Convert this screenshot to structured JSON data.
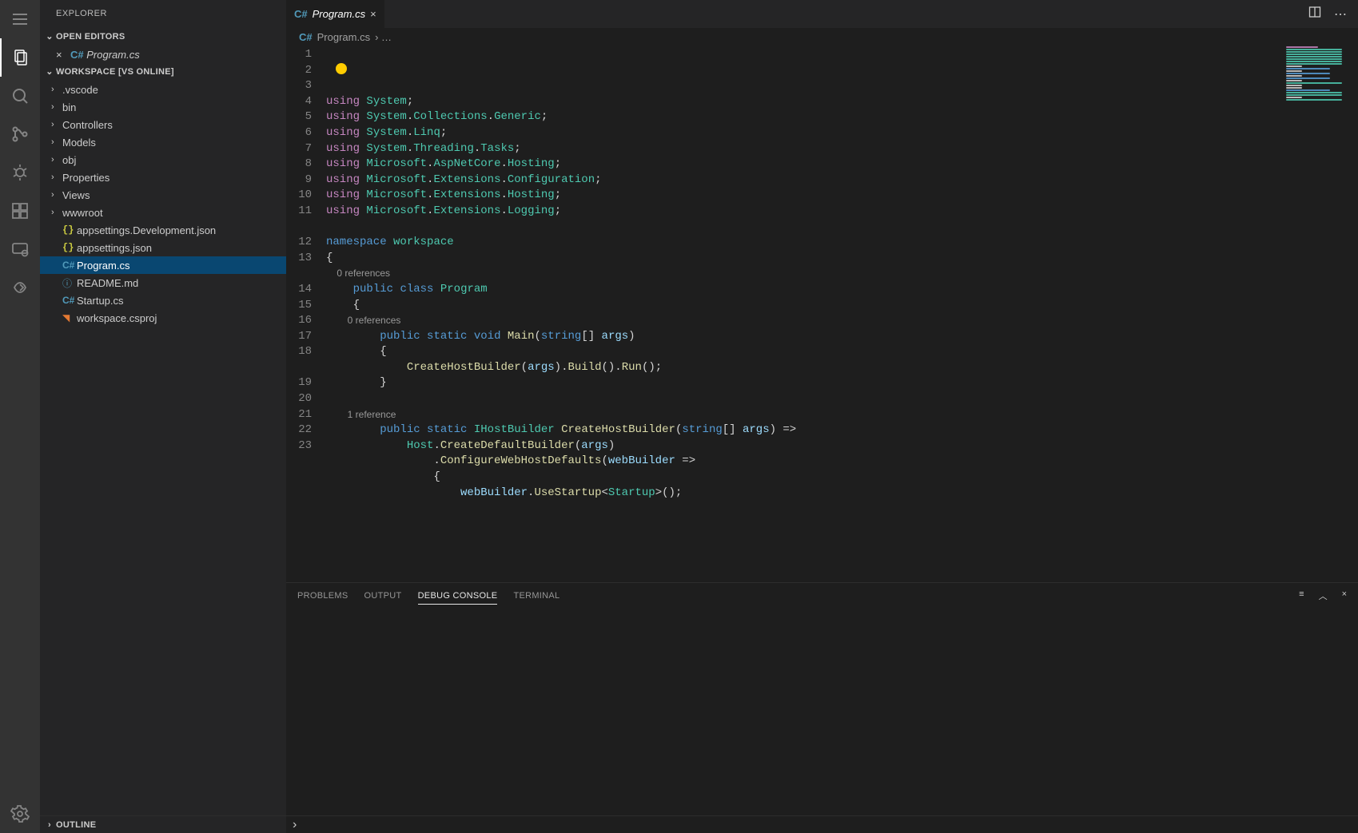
{
  "sidebar": {
    "title": "EXPLORER",
    "openEditorsHeader": "OPEN EDITORS",
    "openEditors": [
      {
        "name": "Program.cs"
      }
    ],
    "workspaceHeader": "WORKSPACE [VS ONLINE]",
    "folders": [
      {
        "name": ".vscode"
      },
      {
        "name": "bin"
      },
      {
        "name": "Controllers"
      },
      {
        "name": "Models"
      },
      {
        "name": "obj"
      },
      {
        "name": "Properties"
      },
      {
        "name": "Views"
      },
      {
        "name": "wwwroot"
      }
    ],
    "files": [
      {
        "name": "appsettings.Development.json",
        "icon": "json"
      },
      {
        "name": "appsettings.json",
        "icon": "json"
      },
      {
        "name": "Program.cs",
        "icon": "cs",
        "selected": true
      },
      {
        "name": "README.md",
        "icon": "info"
      },
      {
        "name": "Startup.cs",
        "icon": "cs"
      },
      {
        "name": "workspace.csproj",
        "icon": "rss"
      }
    ],
    "outlineHeader": "OUTLINE"
  },
  "tab": {
    "name": "Program.cs"
  },
  "breadcrumb": {
    "file": "Program.cs",
    "rest": "›  …"
  },
  "codelens": {
    "zero": "0 references",
    "one": "1 reference"
  },
  "code": {
    "l1": [
      [
        "kw",
        "using"
      ],
      [
        "plain",
        " "
      ],
      [
        "ns",
        "System"
      ],
      [
        "plain",
        ";"
      ]
    ],
    "l2": [
      [
        "kw",
        "using"
      ],
      [
        "plain",
        " "
      ],
      [
        "ns",
        "System"
      ],
      [
        "plain",
        "."
      ],
      [
        "ns",
        "Collections"
      ],
      [
        "plain",
        "."
      ],
      [
        "ns",
        "Generic"
      ],
      [
        "plain",
        ";"
      ]
    ],
    "l3": [
      [
        "kw",
        "using"
      ],
      [
        "plain",
        " "
      ],
      [
        "ns",
        "System"
      ],
      [
        "plain",
        "."
      ],
      [
        "ns",
        "Linq"
      ],
      [
        "plain",
        ";"
      ]
    ],
    "l4": [
      [
        "kw",
        "using"
      ],
      [
        "plain",
        " "
      ],
      [
        "ns",
        "System"
      ],
      [
        "plain",
        "."
      ],
      [
        "ns",
        "Threading"
      ],
      [
        "plain",
        "."
      ],
      [
        "ns",
        "Tasks"
      ],
      [
        "plain",
        ";"
      ]
    ],
    "l5": [
      [
        "kw",
        "using"
      ],
      [
        "plain",
        " "
      ],
      [
        "ns",
        "Microsoft"
      ],
      [
        "plain",
        "."
      ],
      [
        "ns",
        "AspNetCore"
      ],
      [
        "plain",
        "."
      ],
      [
        "ns",
        "Hosting"
      ],
      [
        "plain",
        ";"
      ]
    ],
    "l6": [
      [
        "kw",
        "using"
      ],
      [
        "plain",
        " "
      ],
      [
        "ns",
        "Microsoft"
      ],
      [
        "plain",
        "."
      ],
      [
        "ns",
        "Extensions"
      ],
      [
        "plain",
        "."
      ],
      [
        "ns",
        "Configuration"
      ],
      [
        "plain",
        ";"
      ]
    ],
    "l7": [
      [
        "kw",
        "using"
      ],
      [
        "plain",
        " "
      ],
      [
        "ns",
        "Microsoft"
      ],
      [
        "plain",
        "."
      ],
      [
        "ns",
        "Extensions"
      ],
      [
        "plain",
        "."
      ],
      [
        "ns",
        "Hosting"
      ],
      [
        "plain",
        ";"
      ]
    ],
    "l8": [
      [
        "kw",
        "using"
      ],
      [
        "plain",
        " "
      ],
      [
        "ns",
        "Microsoft"
      ],
      [
        "plain",
        "."
      ],
      [
        "ns",
        "Extensions"
      ],
      [
        "plain",
        "."
      ],
      [
        "ns",
        "Logging"
      ],
      [
        "plain",
        ";"
      ]
    ],
    "l9": [],
    "l10": [
      [
        "kw2",
        "namespace"
      ],
      [
        "plain",
        " "
      ],
      [
        "ns",
        "workspace"
      ]
    ],
    "l11": [
      [
        "plain",
        "{"
      ]
    ],
    "l12": [
      [
        "plain",
        "    "
      ],
      [
        "kw2",
        "public"
      ],
      [
        "plain",
        " "
      ],
      [
        "kw2",
        "class"
      ],
      [
        "plain",
        " "
      ],
      [
        "ns",
        "Program"
      ]
    ],
    "l13": [
      [
        "plain",
        "    {"
      ]
    ],
    "l14": [
      [
        "plain",
        "        "
      ],
      [
        "kw2",
        "public"
      ],
      [
        "plain",
        " "
      ],
      [
        "kw2",
        "static"
      ],
      [
        "plain",
        " "
      ],
      [
        "kw2",
        "void"
      ],
      [
        "plain",
        " "
      ],
      [
        "fn",
        "Main"
      ],
      [
        "plain",
        "("
      ],
      [
        "kw2",
        "string"
      ],
      [
        "plain",
        "[] "
      ],
      [
        "var",
        "args"
      ],
      [
        "plain",
        ")"
      ]
    ],
    "l15": [
      [
        "plain",
        "        {"
      ]
    ],
    "l16": [
      [
        "plain",
        "            "
      ],
      [
        "fn",
        "CreateHostBuilder"
      ],
      [
        "plain",
        "("
      ],
      [
        "var",
        "args"
      ],
      [
        "plain",
        ")."
      ],
      [
        "fn",
        "Build"
      ],
      [
        "plain",
        "()."
      ],
      [
        "fn",
        "Run"
      ],
      [
        "plain",
        "();"
      ]
    ],
    "l17": [
      [
        "plain",
        "        }"
      ]
    ],
    "l18": [],
    "l19": [
      [
        "plain",
        "        "
      ],
      [
        "kw2",
        "public"
      ],
      [
        "plain",
        " "
      ],
      [
        "kw2",
        "static"
      ],
      [
        "plain",
        " "
      ],
      [
        "ns",
        "IHostBuilder"
      ],
      [
        "plain",
        " "
      ],
      [
        "fn",
        "CreateHostBuilder"
      ],
      [
        "plain",
        "("
      ],
      [
        "kw2",
        "string"
      ],
      [
        "plain",
        "[] "
      ],
      [
        "var",
        "args"
      ],
      [
        "plain",
        ") =>"
      ]
    ],
    "l20": [
      [
        "plain",
        "            "
      ],
      [
        "ns",
        "Host"
      ],
      [
        "plain",
        "."
      ],
      [
        "fn",
        "CreateDefaultBuilder"
      ],
      [
        "plain",
        "("
      ],
      [
        "var",
        "args"
      ],
      [
        "plain",
        ")"
      ]
    ],
    "l21": [
      [
        "plain",
        "                ."
      ],
      [
        "fn",
        "ConfigureWebHostDefaults"
      ],
      [
        "plain",
        "("
      ],
      [
        "var",
        "webBuilder"
      ],
      [
        "plain",
        " =>"
      ]
    ],
    "l22": [
      [
        "plain",
        "                {"
      ]
    ],
    "l23": [
      [
        "plain",
        "                    "
      ],
      [
        "var",
        "webBuilder"
      ],
      [
        "plain",
        "."
      ],
      [
        "fn",
        "UseStartup"
      ],
      [
        "plain",
        "<"
      ],
      [
        "ns",
        "Startup"
      ],
      [
        "plain",
        ">();"
      ]
    ]
  },
  "lineNumbers": [
    "1",
    "2",
    "3",
    "4",
    "5",
    "6",
    "7",
    "8",
    "9",
    "10",
    "11",
    "12",
    "13",
    "14",
    "15",
    "16",
    "17",
    "18",
    "19",
    "20",
    "21",
    "22",
    "23"
  ],
  "panel": {
    "tabs": [
      "PROBLEMS",
      "OUTPUT",
      "DEBUG CONSOLE",
      "TERMINAL"
    ],
    "active": 2
  }
}
